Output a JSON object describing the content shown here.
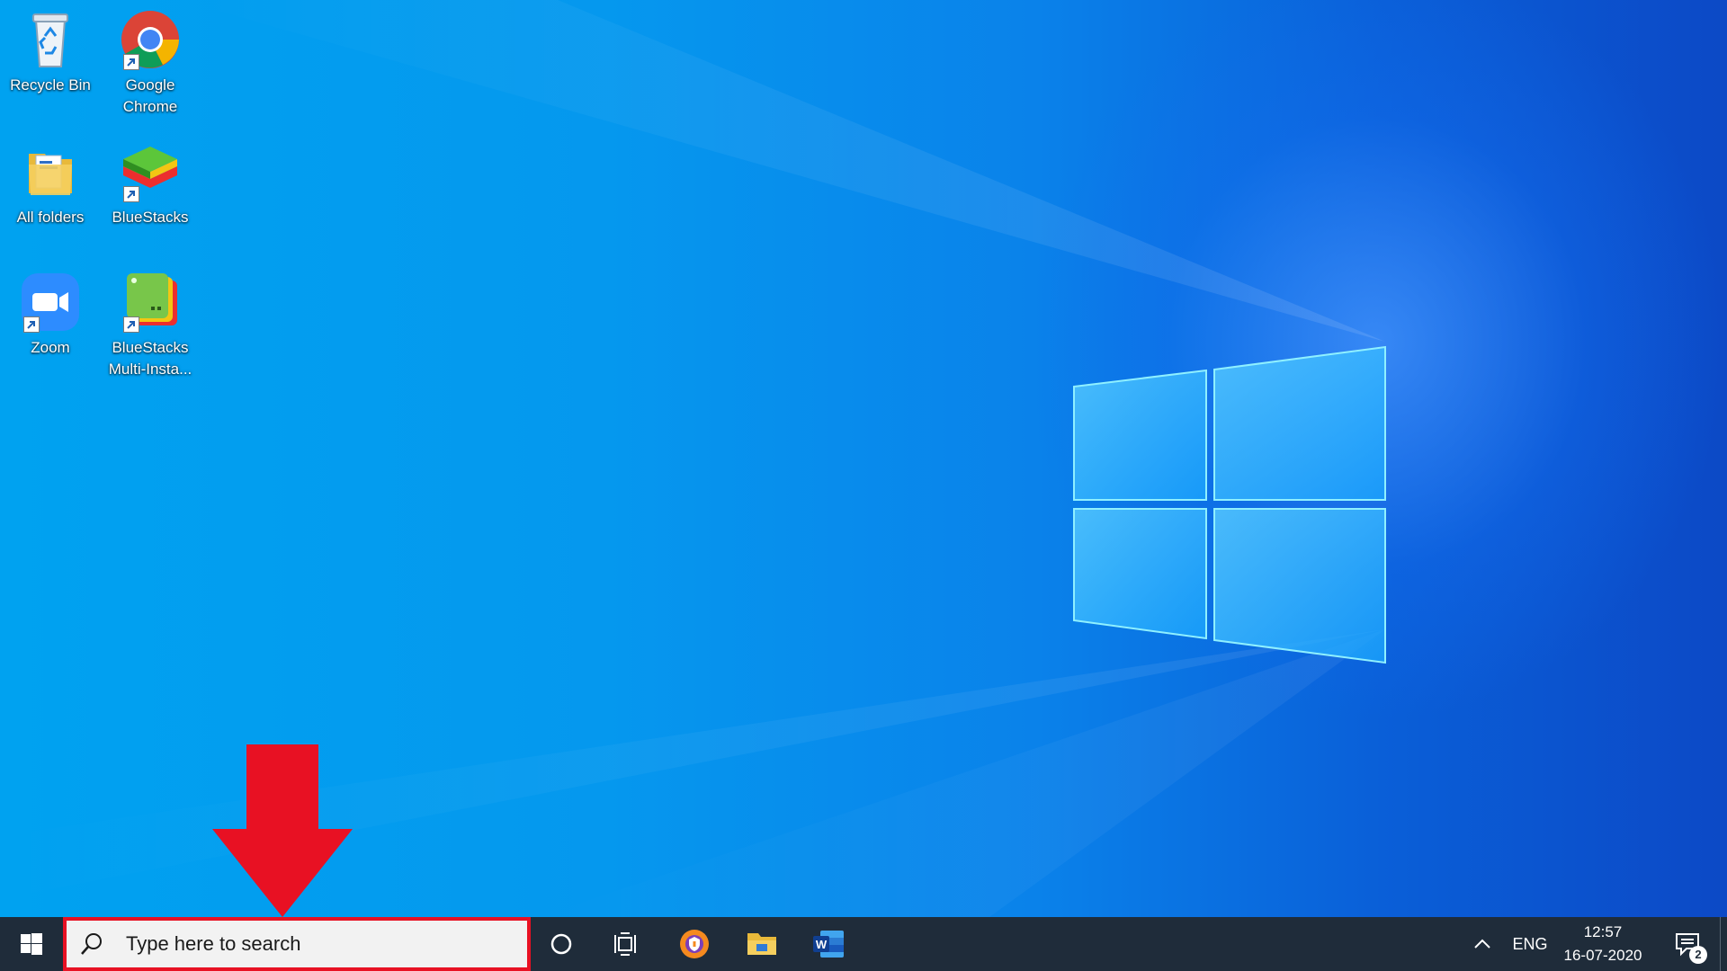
{
  "desktop": {
    "icons": [
      {
        "label": "Recycle Bin",
        "icon": "recycle-bin-icon"
      },
      {
        "label": "Google Chrome",
        "icon": "google-chrome-icon"
      },
      {
        "label": "All folders",
        "icon": "folder-icon"
      },
      {
        "label": "BlueStacks",
        "icon": "bluestacks-icon"
      },
      {
        "label": "Zoom",
        "icon": "zoom-icon"
      },
      {
        "label": "BlueStacks Multi-Insta...",
        "icon": "bluestacks-multi-instance-icon"
      }
    ]
  },
  "annotation": {
    "arrow_color": "#e81123",
    "highlight_color": "#e81123"
  },
  "taskbar": {
    "search_placeholder": "Type here to search",
    "apps": [
      "cortana-icon",
      "task-view-icon",
      "avast-secure-browser-icon",
      "file-explorer-icon",
      "word-icon"
    ],
    "tray": {
      "language": "ENG",
      "time": "12:57",
      "date": "16-07-2020",
      "notification_count": "2"
    },
    "background_color": "#1f2c3a"
  }
}
